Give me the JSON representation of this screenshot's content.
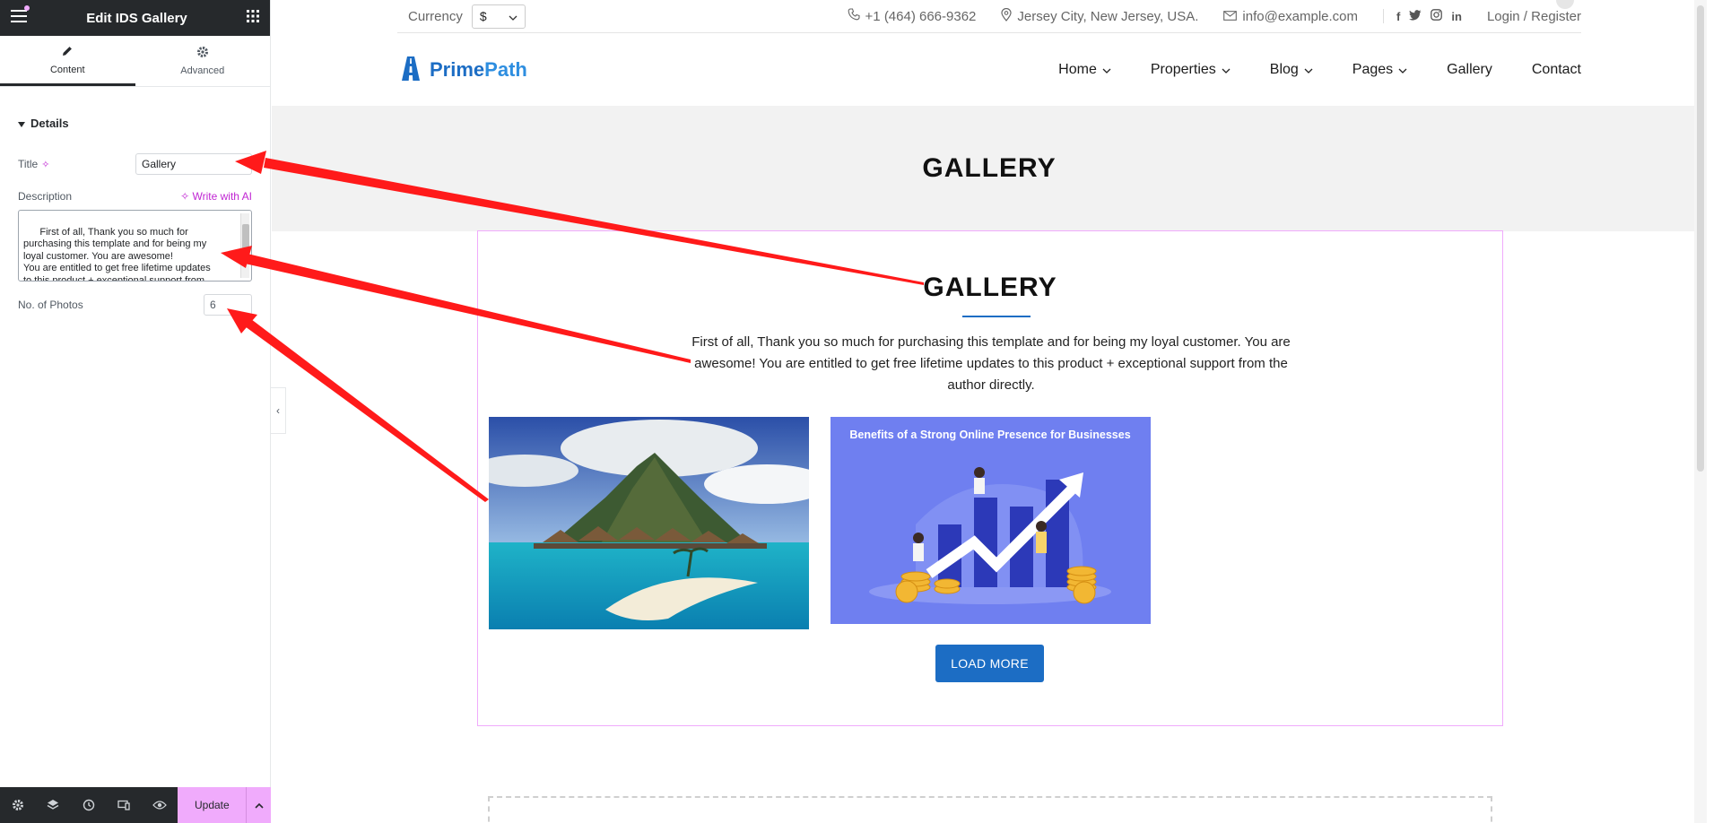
{
  "editor": {
    "title": "Edit IDS Gallery",
    "tabs": [
      {
        "label": "Content",
        "icon": "pencil-icon",
        "active": true
      },
      {
        "label": "Advanced",
        "icon": "gear-icon",
        "active": false
      }
    ],
    "section": "Details",
    "fields": {
      "title_label": "Title",
      "title_value": "Gallery",
      "description_label": "Description",
      "write_ai": "Write with AI",
      "description_value": "First of all, Thank you so much for\npurchasing this template and for being my\nloyal customer. You are awesome!\nYou are entitled to get free lifetime updates\nto this product + exceptional support from\nthe author directly!",
      "photos_label": "No. of Photos",
      "photos_value": "6"
    },
    "footer": {
      "update_label": "Update"
    }
  },
  "site": {
    "topbar": {
      "currency_label": "Currency",
      "currency_value": "$",
      "phone": "+1 (464) 666-9362",
      "location": "Jersey City, New Jersey, USA.",
      "email": "info@example.com",
      "login": "Login / Register"
    },
    "logo": {
      "part1": "Prime",
      "part2": "Path"
    },
    "nav": [
      {
        "label": "Home",
        "dropdown": true
      },
      {
        "label": "Properties",
        "dropdown": true
      },
      {
        "label": "Blog",
        "dropdown": true
      },
      {
        "label": "Pages",
        "dropdown": true
      },
      {
        "label": "Gallery",
        "dropdown": false
      },
      {
        "label": "Contact",
        "dropdown": false
      }
    ],
    "hero_title": "GALLERY",
    "gallery": {
      "title": "GALLERY",
      "description": "First of all, Thank you so much for purchasing this template and for being my loyal customer. You are awesome! You are entitled to get free lifetime updates to this product + exceptional support from the author directly.",
      "photo2_caption": "Benefits of a Strong Online Presence for Businesses",
      "load_more": "LOAD MORE"
    }
  },
  "colors": {
    "accent": "#1c6dc4",
    "editor_dark": "#26292c",
    "editor_pink": "#f0abfc",
    "arrow": "#ff1a1a"
  }
}
